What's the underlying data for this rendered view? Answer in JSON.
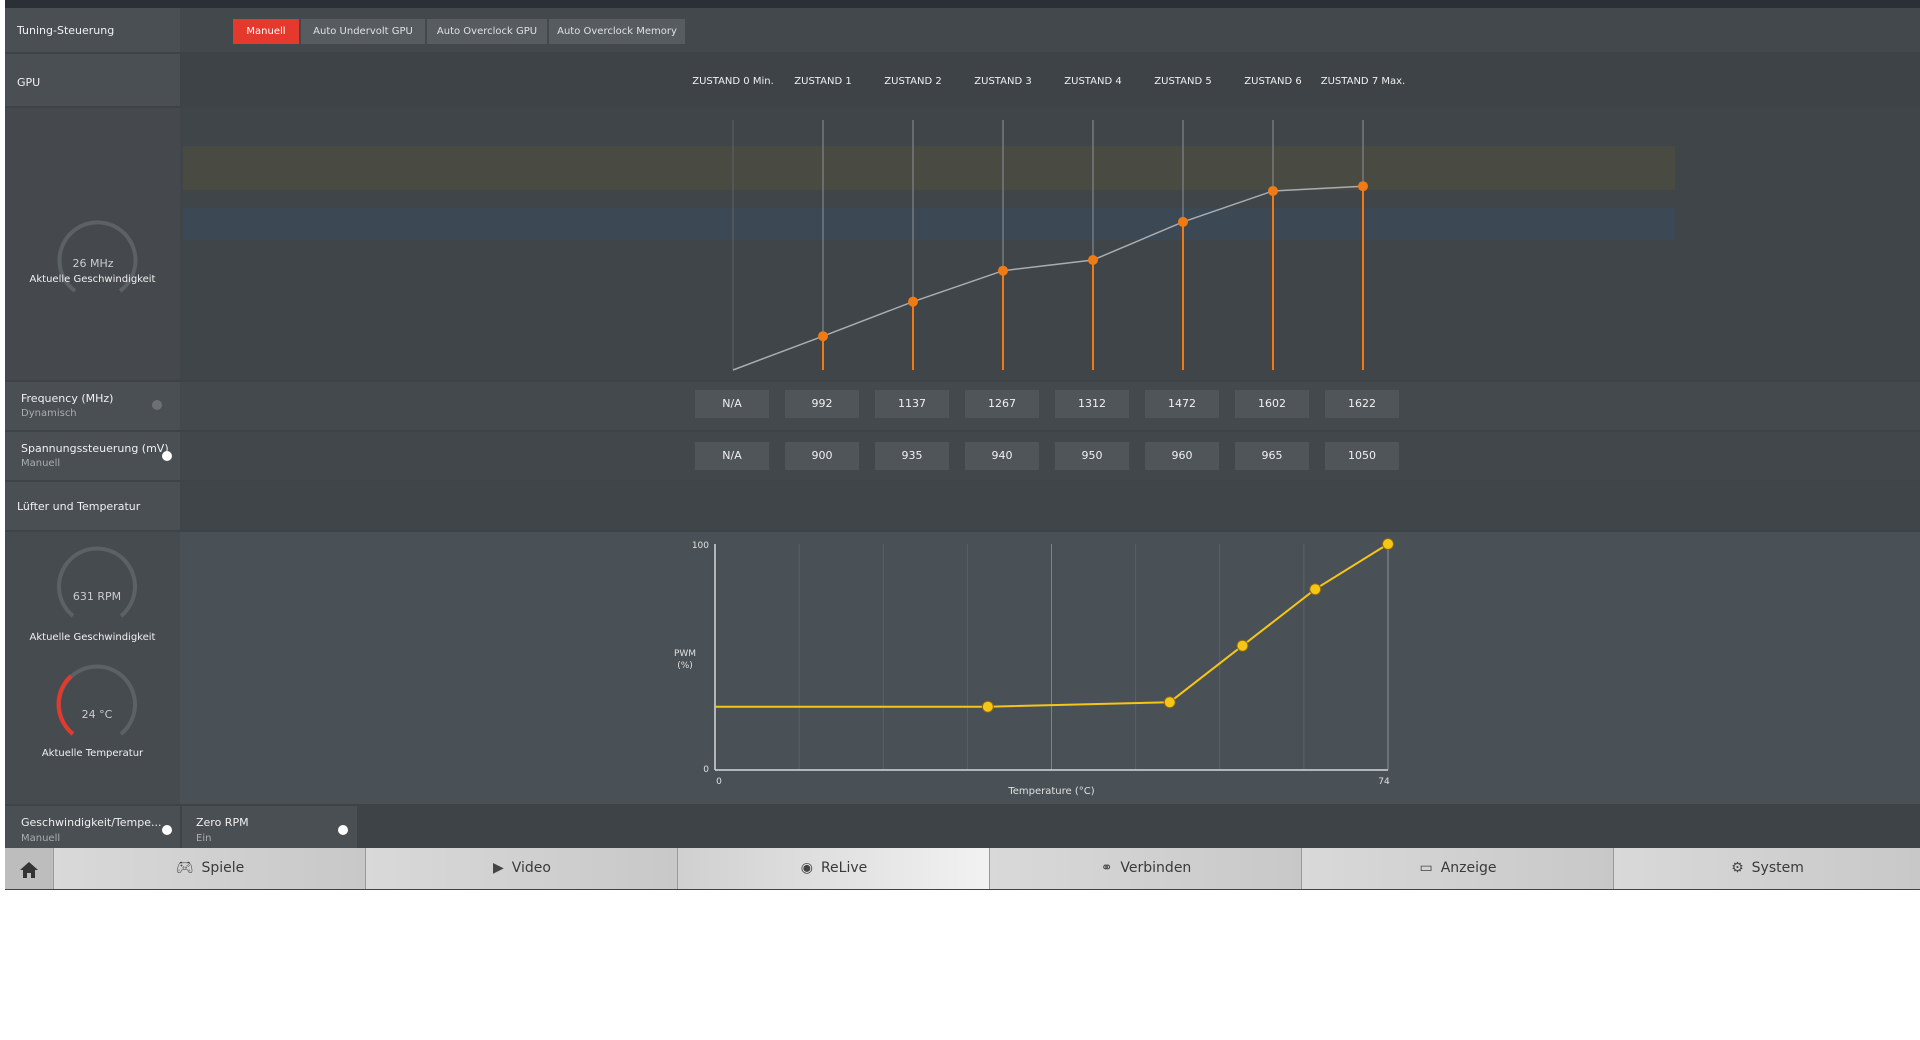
{
  "tuning": {
    "title": "Tuning-Steuerung",
    "tabs": [
      "Manuell",
      "Auto Undervolt GPU",
      "Auto Overclock GPU",
      "Auto Overclock Memory"
    ],
    "active_tab": "Manuell"
  },
  "gpu": {
    "section_label": "GPU",
    "gauge_value": "26 MHz",
    "gauge_caption": "Aktuelle Geschwindigkeit",
    "states": [
      "ZUSTAND 0 Min.",
      "ZUSTAND 1",
      "ZUSTAND 2",
      "ZUSTAND 3",
      "ZUSTAND 4",
      "ZUSTAND 5",
      "ZUSTAND 6",
      "ZUSTAND 7 Max."
    ],
    "frequency": {
      "label": "Frequency (MHz)",
      "mode": "Dynamisch",
      "values": [
        "N/A",
        "992",
        "1137",
        "1267",
        "1312",
        "1472",
        "1602",
        "1622"
      ]
    },
    "voltage": {
      "label": "Spannungssteuerung (mV)",
      "mode": "Manuell",
      "values": [
        "N/A",
        "900",
        "935",
        "940",
        "950",
        "960",
        "965",
        "1050"
      ]
    }
  },
  "fan": {
    "section_label": "Lüfter und Temperatur",
    "rpm_gauge": "631 RPM",
    "rpm_caption": "Aktuelle Geschwindigkeit",
    "temp_gauge": "24 °C",
    "temp_caption": "Aktuelle Temperatur",
    "speed_temp": {
      "label": "Geschwindigkeit/Tempe...",
      "mode": "Manuell"
    },
    "zero_rpm": {
      "label": "Zero RPM",
      "mode": "Ein"
    }
  },
  "chart_data": [
    {
      "type": "line",
      "series": [
        {
          "values": [
            850,
            992,
            1137,
            1267,
            1312,
            1472,
            1602,
            1622
          ]
        }
      ],
      "categories": [
        "ZUSTAND 0 Min.",
        "ZUSTAND 1",
        "ZUSTAND 2",
        "ZUSTAND 3",
        "ZUSTAND 4",
        "ZUSTAND 5",
        "ZUSTAND 6",
        "ZUSTAND 7 Max."
      ],
      "color": "#f07a14"
    },
    {
      "type": "line",
      "xlabel": "Temperature (°C)",
      "ylabel": "PWM\n(%)",
      "xlim": [
        0,
        74
      ],
      "ylim": [
        0,
        100
      ],
      "x_ticks": [
        "0",
        "74"
      ],
      "y_ticks": [
        "0",
        "100"
      ],
      "x": [
        0,
        30,
        50,
        58,
        66,
        74
      ],
      "y": [
        28,
        28,
        30,
        55,
        80,
        100
      ],
      "color": "#f5c518"
    }
  ],
  "navbar": {
    "items": [
      {
        "label": "Spiele",
        "icon": "gamepad-icon"
      },
      {
        "label": "Video",
        "icon": "play-icon"
      },
      {
        "label": "ReLive",
        "icon": "relive-icon"
      },
      {
        "label": "Verbinden",
        "icon": "connect-icon"
      },
      {
        "label": "Anzeige",
        "icon": "display-icon"
      },
      {
        "label": "System",
        "icon": "system-gear-icon"
      }
    ]
  }
}
